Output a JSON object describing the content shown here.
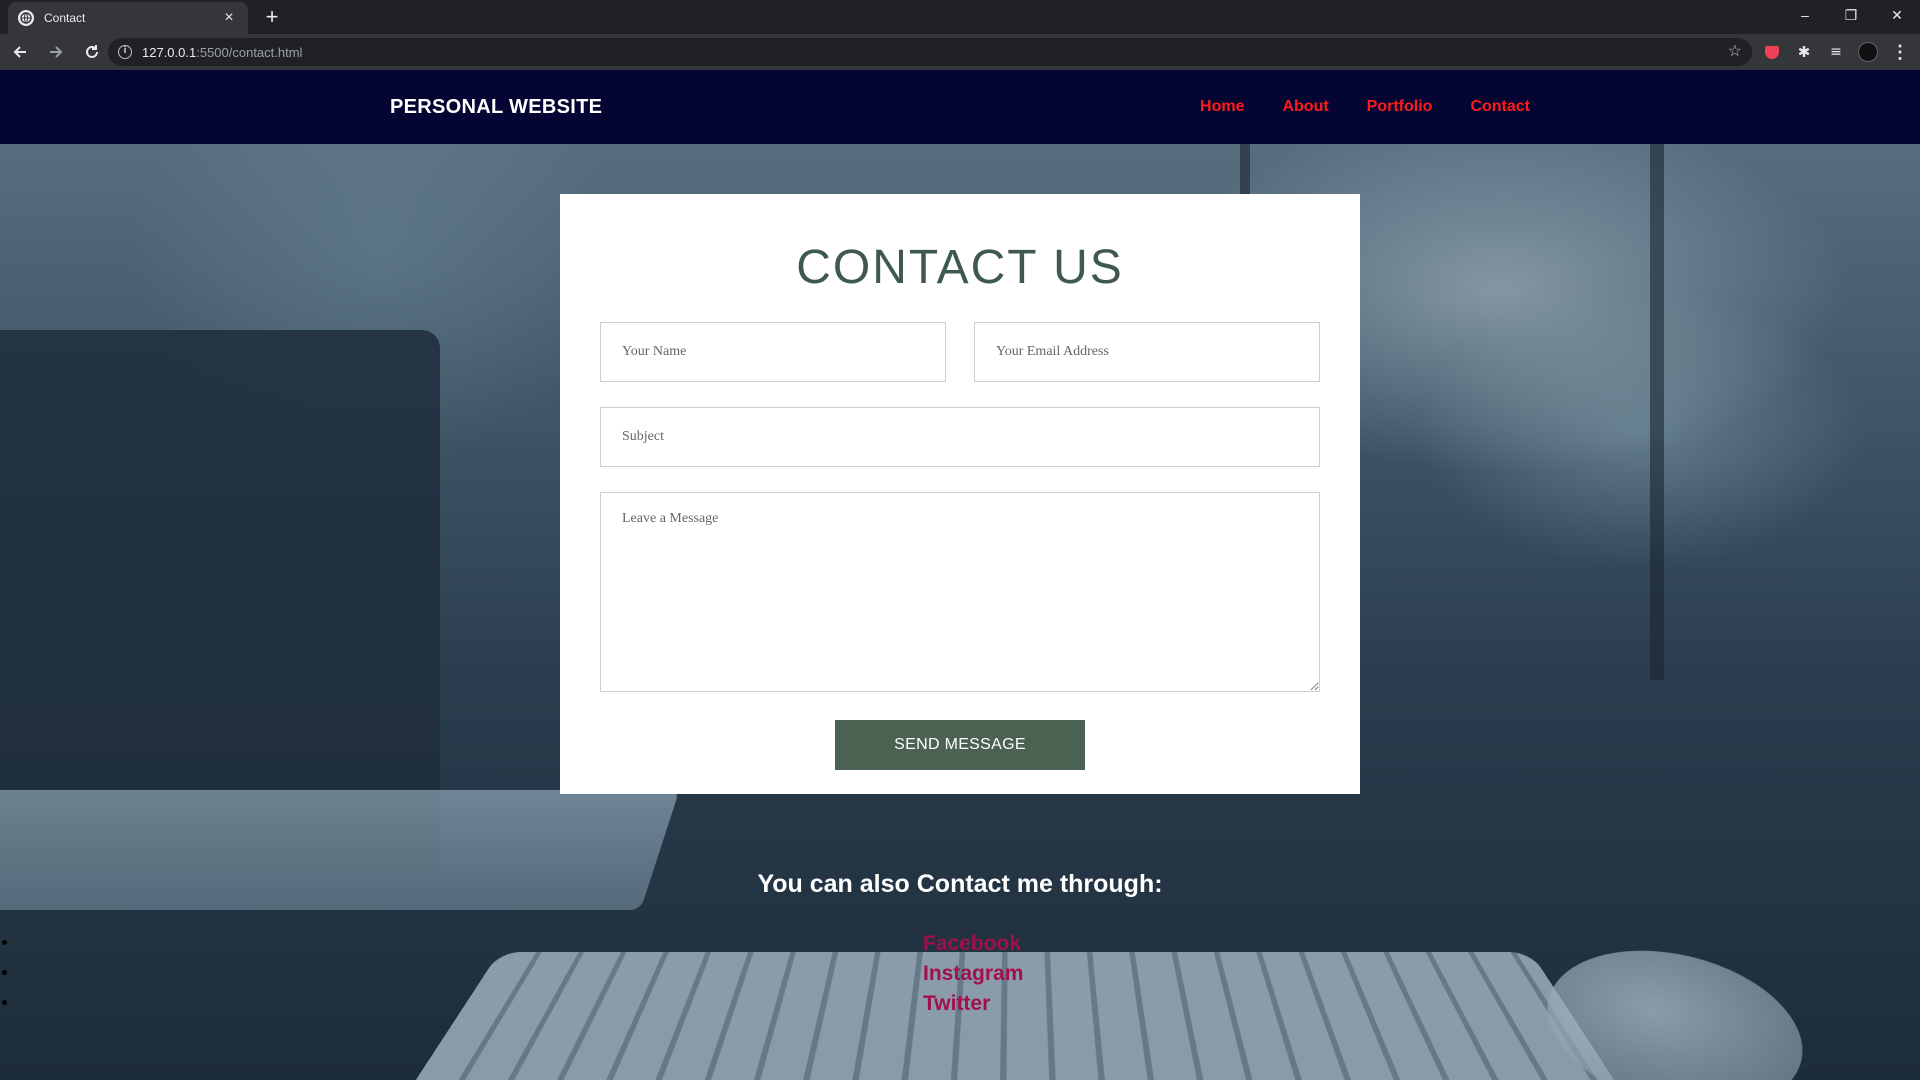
{
  "browser": {
    "tab_title": "Contact",
    "new_tab_label": "+",
    "url_host": "127.0.0.1",
    "url_path": ":5500/contact.html",
    "window_controls": {
      "minimize": "–",
      "restore": "❐",
      "close": "✕"
    },
    "icons": [
      "globe-icon",
      "close-icon",
      "back-icon",
      "forward-icon",
      "reload-icon",
      "info-icon",
      "star-icon",
      "pocket-icon",
      "puzzle-icon",
      "media-icon",
      "avatar",
      "menu-icon"
    ]
  },
  "site": {
    "brand": "PERSONAL WEBSITE",
    "nav": [
      {
        "label": "Home"
      },
      {
        "label": "About"
      },
      {
        "label": "Portfolio"
      },
      {
        "label": "Contact"
      }
    ],
    "nav_color": "#ff1a1a",
    "header_bg": "#050533"
  },
  "form": {
    "title": "CONTACT US",
    "name_placeholder": "Your Name",
    "email_placeholder": "Your Email Address",
    "subject_placeholder": "Subject",
    "message_placeholder": "Leave a Message",
    "submit_label": "SEND MESSAGE",
    "accent": "#4b6152"
  },
  "social": {
    "heading": "You can also Contact me through:",
    "links": [
      {
        "label": "Facebook"
      },
      {
        "label": "Instagram"
      },
      {
        "label": "Twitter"
      }
    ],
    "link_color": "#a0104a"
  }
}
